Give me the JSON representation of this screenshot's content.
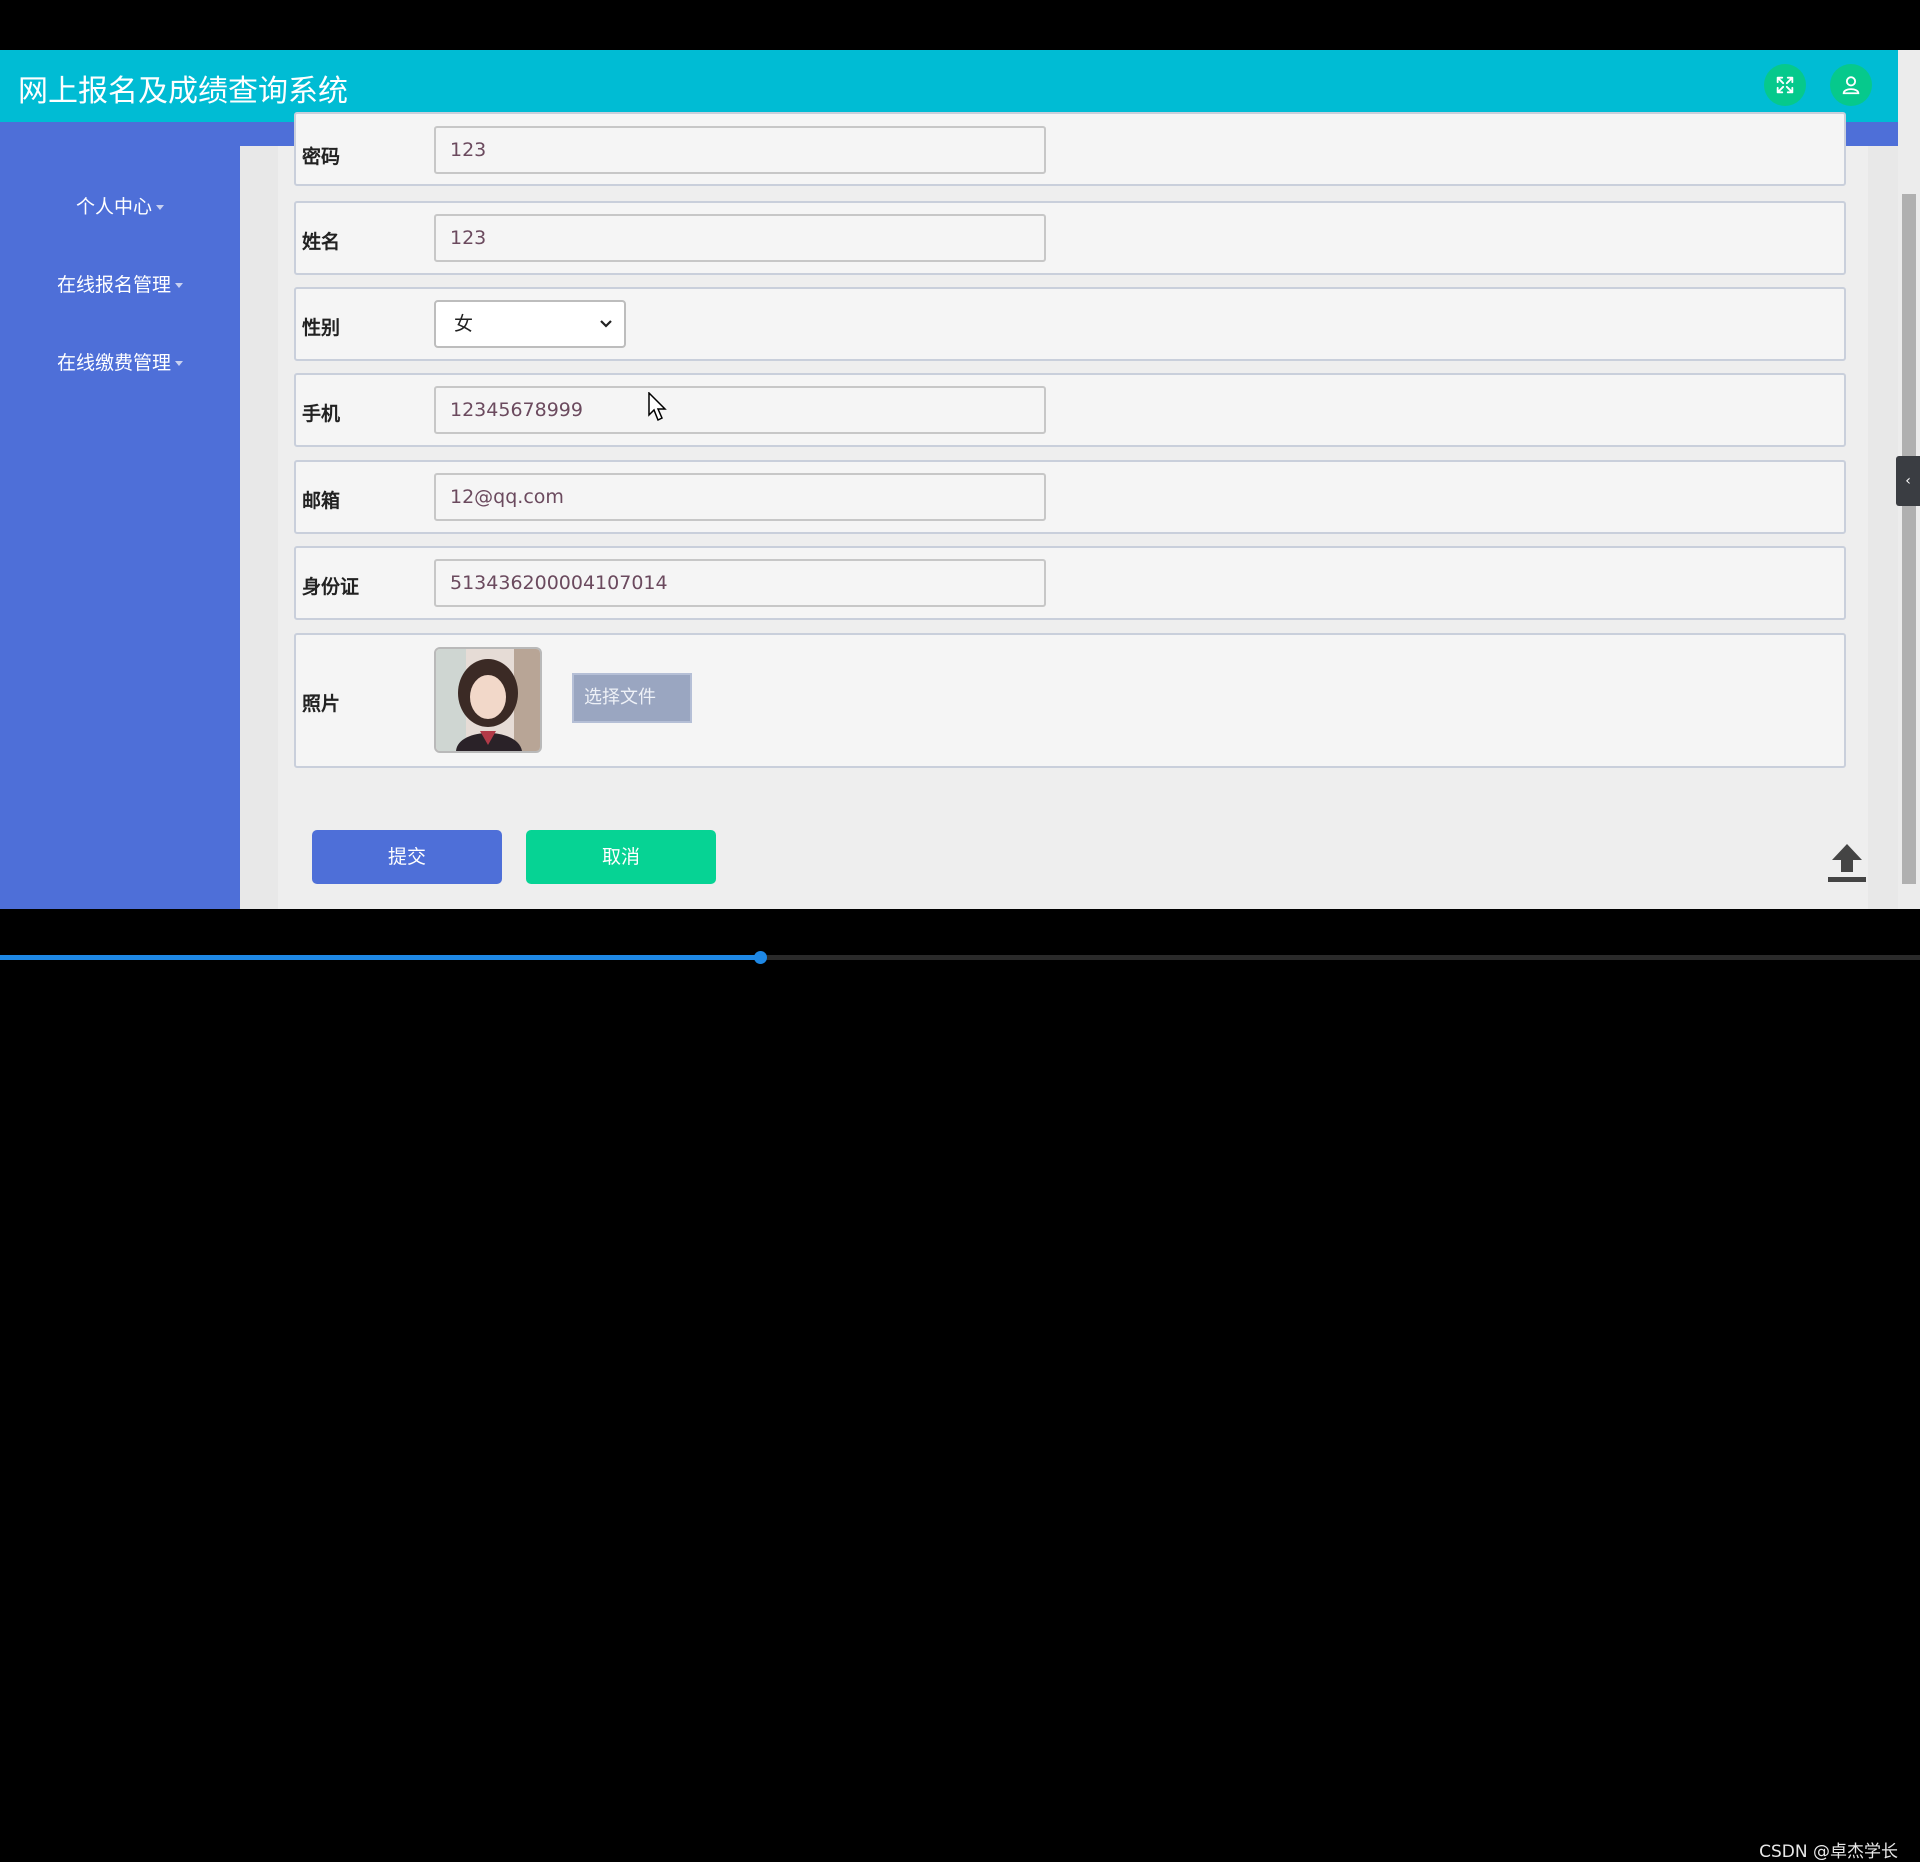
{
  "app": {
    "title": "网上报名及成绩查询系统"
  },
  "header": {
    "fullscreen_icon": "expand-arrows-icon",
    "user_icon": "user-icon"
  },
  "sidebar": {
    "items": [
      {
        "label": "个人中心"
      },
      {
        "label": "在线报名管理"
      },
      {
        "label": "在线缴费管理"
      }
    ]
  },
  "form": {
    "password": {
      "label": "密码",
      "value": "123"
    },
    "name": {
      "label": "姓名",
      "value": "123"
    },
    "gender": {
      "label": "性别",
      "selected": "女"
    },
    "phone": {
      "label": "手机",
      "value": "12345678999"
    },
    "email": {
      "label": "邮箱",
      "value": "12@qq.com"
    },
    "id_card": {
      "label": "身份证",
      "value": "513436200004107014"
    },
    "photo": {
      "label": "照片",
      "file_button": "选择文件"
    }
  },
  "actions": {
    "submit": "提交",
    "cancel": "取消"
  },
  "side_tab": {
    "icon": "chevron-left-icon"
  },
  "video": {
    "progress": 0.396
  },
  "watermark": "CSDN @卓杰学长"
}
